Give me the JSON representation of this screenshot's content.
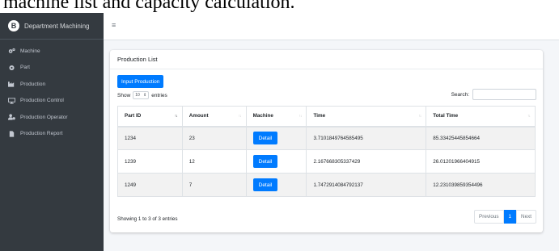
{
  "caption": "machine list and capacity calculation.",
  "brand": {
    "logo_letter": "B",
    "name": "Department Machining"
  },
  "sidebar": {
    "items": [
      {
        "label": "Machine",
        "icon": "cogs-icon"
      },
      {
        "label": "Part",
        "icon": "cog-icon"
      },
      {
        "label": "Production",
        "icon": "industry-icon"
      },
      {
        "label": "Production Control",
        "icon": "desktop-icon"
      },
      {
        "label": "Production Operator",
        "icon": "user-cog-icon"
      },
      {
        "label": "Production Report",
        "icon": "file-icon"
      }
    ]
  },
  "topbar": {
    "menu_icon": "≡"
  },
  "card": {
    "title": "Production List",
    "input_button": "Input Production",
    "show_label": "Show",
    "length_value": "10",
    "entries_label": "entries",
    "search_label": "Search:",
    "search_value": ""
  },
  "table": {
    "headers": [
      "Part ID",
      "Amount",
      "Machine",
      "Time",
      "Total Time"
    ],
    "rows": [
      {
        "part_id": "1234",
        "amount": "23",
        "machine": "Detail",
        "time": "3.7101849764585495",
        "total_time": "85.33425445854664"
      },
      {
        "part_id": "1239",
        "amount": "12",
        "machine": "Detail",
        "time": "2.167668305337429",
        "total_time": "26.01201966404915"
      },
      {
        "part_id": "1249",
        "amount": "7",
        "machine": "Detail",
        "time": "1.7472914084792137",
        "total_time": "12.231039859354496"
      }
    ]
  },
  "footer": {
    "info": "Showing 1 to 3 of 3 entries",
    "previous": "Previous",
    "page": "1",
    "next": "Next"
  },
  "colors": {
    "sidebar": "#343a40",
    "primary": "#007bff",
    "background": "#f4f6f9"
  }
}
